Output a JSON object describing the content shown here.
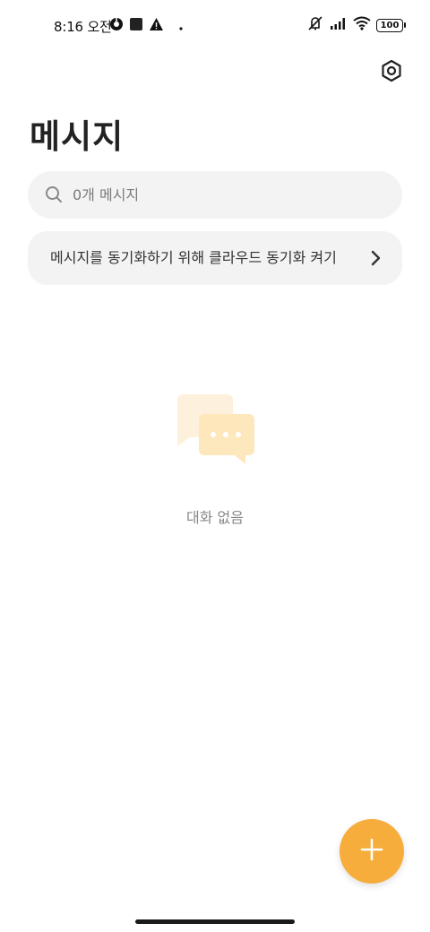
{
  "status_bar": {
    "time": "8:16 오전",
    "battery": "100",
    "icons": [
      "chrome-icon",
      "square-notification-icon",
      "warning-icon",
      "dot-icon",
      "mute-icon",
      "signal-icon",
      "wifi-icon",
      "battery-icon"
    ]
  },
  "header": {
    "title": "메시지",
    "settings_icon": "settings-icon"
  },
  "search": {
    "placeholder": "0개 메시지",
    "icon": "search-icon"
  },
  "sync_banner": {
    "label": "메시지를 동기화하기 위해 클라우드 동기화 켜기",
    "icon": "chevron-right-icon"
  },
  "empty_state": {
    "label": "대화 없음",
    "illustration": "chat-bubbles-icon"
  },
  "fab": {
    "icon": "plus-icon",
    "color": "#f6ad3c"
  },
  "colors": {
    "accent": "#f6ad3c",
    "surface": "#f3f3f3"
  }
}
